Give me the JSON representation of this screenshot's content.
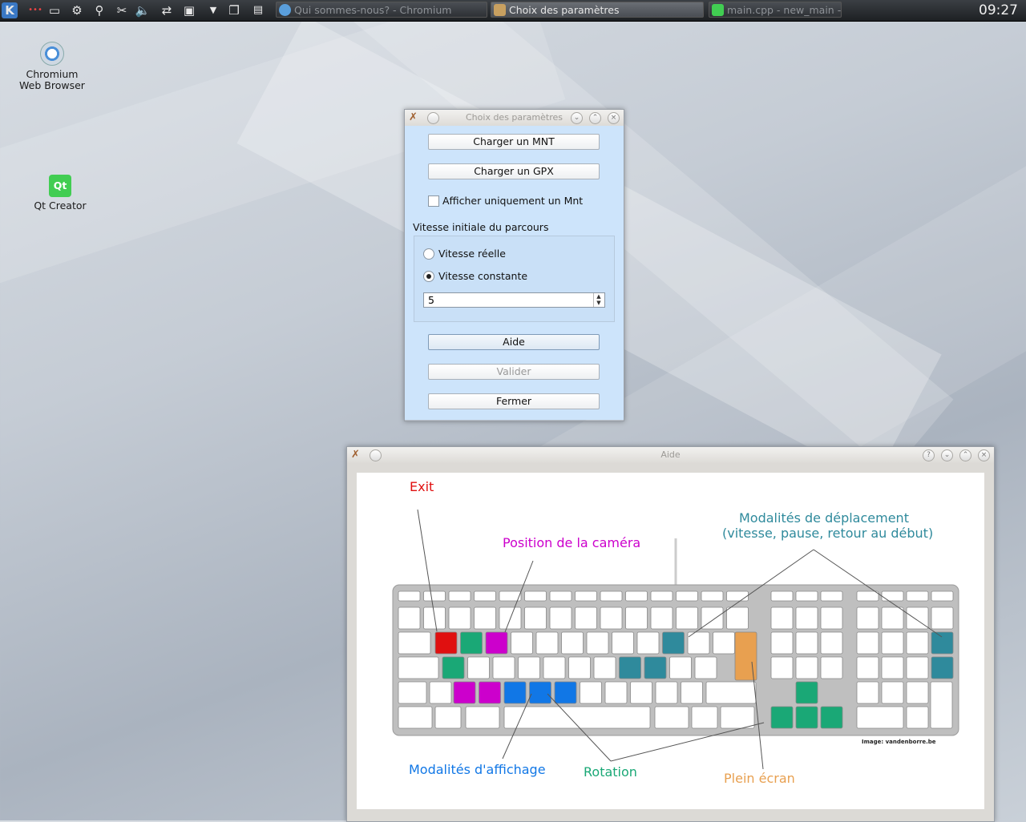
{
  "taskbar": {
    "tasks": [
      {
        "label": "Qui sommes-nous? - Chromium",
        "active": false
      },
      {
        "label": "Choix des paramètres",
        "active": true
      },
      {
        "label": "main.cpp - new_main - Qt Creator",
        "active": false
      }
    ],
    "clock": "09:27"
  },
  "desktop": {
    "icons": [
      {
        "label": "Chromium\nWeb Browser",
        "icon": "chromium-icon"
      },
      {
        "label": "Qt Creator",
        "icon": "qt-creator-icon"
      }
    ]
  },
  "dialog": {
    "title": "Choix des paramètres",
    "load_mnt": "Charger un MNT",
    "load_gpx": "Charger un GPX",
    "only_mnt": "Afficher uniquement un Mnt",
    "only_mnt_checked": false,
    "speed_group": "Vitesse initiale du parcours",
    "real_speed": "Vitesse réelle",
    "constant_speed": "Vitesse constante",
    "selected_speed": "constant",
    "speed_value": "5",
    "help": "Aide",
    "validate": "Valider",
    "close": "Fermer"
  },
  "help_window": {
    "title": "Aide",
    "callouts": {
      "exit": "Exit",
      "camera": "Position de la caméra",
      "movement_1": "Modalités de déplacement",
      "movement_2": "(vitesse, pause, retour au début)",
      "display": "Modalités d'affichage",
      "rotation": "Rotation",
      "fullscreen": "Plein écran",
      "credit": "Image: vandenborre.be"
    },
    "colors": {
      "exit": "#e01010",
      "camera": "#cc00cc",
      "movement": "#2f8a9c",
      "display": "#1177e6",
      "rotation": "#1aa876",
      "fullscreen": "#e8a050"
    }
  }
}
